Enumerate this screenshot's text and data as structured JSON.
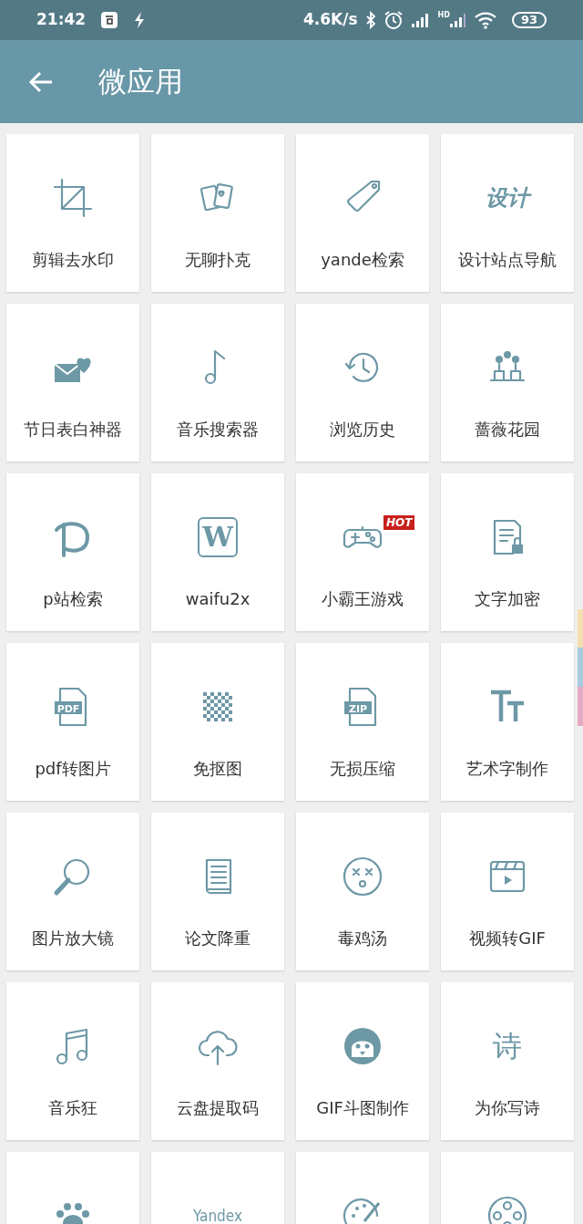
{
  "status_bar": {
    "time": "21:42",
    "network_speed": "4.6K/s",
    "signal_label": "HD",
    "battery": "93"
  },
  "app_bar": {
    "title": "微应用"
  },
  "tiles": [
    {
      "label": "剪辑去水印"
    },
    {
      "label": "无聊扑克"
    },
    {
      "label": "yande检索"
    },
    {
      "label": "设计站点导航",
      "icon_text": "设计"
    },
    {
      "label": "节日表白神器"
    },
    {
      "label": "音乐搜索器"
    },
    {
      "label": "浏览历史"
    },
    {
      "label": "蔷薇花园"
    },
    {
      "label": "p站检索"
    },
    {
      "label": "waifu2x",
      "icon_text": "W"
    },
    {
      "label": "小霸王游戏",
      "badge": "HOT"
    },
    {
      "label": "文字加密"
    },
    {
      "label": "pdf转图片",
      "icon_text": "PDF"
    },
    {
      "label": "免抠图"
    },
    {
      "label": "无损压缩",
      "icon_text": "ZIP"
    },
    {
      "label": "艺术字制作"
    },
    {
      "label": "图片放大镜"
    },
    {
      "label": "论文降重"
    },
    {
      "label": "毒鸡汤"
    },
    {
      "label": "视频转GIF"
    },
    {
      "label": "音乐狂"
    },
    {
      "label": "云盘提取码"
    },
    {
      "label": "GIF斗图制作"
    },
    {
      "label": "为你写诗",
      "icon_text": "诗"
    },
    {
      "kind": "app"
    },
    {
      "kind": "app",
      "icon_text": "Yandex"
    },
    {
      "kind": "app"
    },
    {
      "kind": "app"
    }
  ]
}
